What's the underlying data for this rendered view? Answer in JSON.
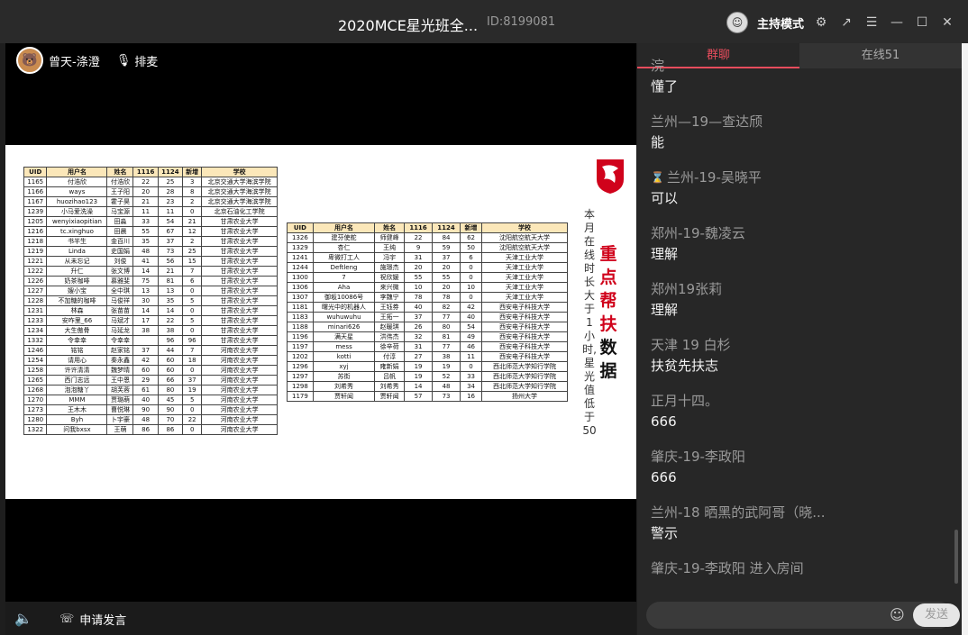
{
  "titlebar": {
    "title": "2020MCE星光班全...",
    "room_id": "ID:8199081",
    "host_mode": "主持模式"
  },
  "presenter": {
    "name": "曾天-涤澄",
    "mic_label": "排麦"
  },
  "bottom": {
    "apply_label": "申请发言"
  },
  "tabs": [
    {
      "label": "群聊"
    },
    {
      "label": "在线51"
    }
  ],
  "messages": [
    {
      "user": "浣",
      "text": "懂了"
    },
    {
      "user": "兰州—19—查达颀",
      "text": "能"
    },
    {
      "user": "兰州-19-吴晓平",
      "text": "可以",
      "badge": true
    },
    {
      "user": "郑州-19-魏凌云",
      "text": "理解"
    },
    {
      "user": "郑州19张莉",
      "text": "理解"
    },
    {
      "user": "天津 19 白杉",
      "text": "扶贫先扶志"
    },
    {
      "user": "正月十四。",
      "text": "666"
    },
    {
      "user": "肇庆-19-李政阳",
      "text": "666"
    },
    {
      "user": "兰州-18 晒黑的武阿哥（晓...",
      "text": "警示"
    },
    {
      "user": "肇庆-19-李政阳 进入房间",
      "text": ""
    }
  ],
  "send_label": "发送",
  "slide": {
    "side_gray": "本月在线时长大于1小时,星光值低于50",
    "side_red": "重点帮扶",
    "side_black": "数据",
    "headers": [
      "UID",
      "用户名",
      "姓名",
      "1116",
      "1124",
      "新增",
      "学校"
    ],
    "table1": [
      [
        "1165",
        "付浩欣",
        "付浩欣",
        "22",
        "25",
        "3",
        "北京交通大学海滨学院"
      ],
      [
        "1166",
        "ways",
        "王子阳",
        "20",
        "28",
        "8",
        "北京交通大学海滨学院"
      ],
      [
        "1167",
        "huozihao123",
        "霍子昊",
        "21",
        "23",
        "2",
        "北京交通大学海滨学院"
      ],
      [
        "1239",
        "小马爱洗澡",
        "马宝源",
        "11",
        "11",
        "0",
        "北京石油化工学院"
      ],
      [
        "1205",
        "wenyixiaopitian",
        "田淼",
        "33",
        "54",
        "21",
        "甘肃农业大学"
      ],
      [
        "1216",
        "tc.xinghuo",
        "田晨",
        "55",
        "67",
        "12",
        "甘肃农业大学"
      ],
      [
        "1218",
        "书半生",
        "金百川",
        "35",
        "37",
        "2",
        "甘肃农业大学"
      ],
      [
        "1219",
        "Linda",
        "史国娟",
        "48",
        "73",
        "25",
        "甘肃农业大学"
      ],
      [
        "1221",
        "从未忘记",
        "刘俊",
        "41",
        "56",
        "15",
        "甘肃农业大学"
      ],
      [
        "1222",
        "升仁",
        "张文博",
        "14",
        "21",
        "7",
        "甘肃农业大学"
      ],
      [
        "1226",
        "奶茶咖啡",
        "慕雅斐",
        "75",
        "81",
        "6",
        "甘肃农业大学"
      ],
      [
        "1227",
        "嫂小宝",
        "全中琪",
        "13",
        "13",
        "0",
        "甘肃农业大学"
      ],
      [
        "1228",
        "不加糖的咖啡",
        "马俊祥",
        "30",
        "35",
        "5",
        "甘肃农业大学"
      ],
      [
        "1231",
        "林森",
        "张苗苗",
        "14",
        "14",
        "0",
        "甘肃农业大学"
      ],
      [
        "1233",
        "安咋里_66",
        "马斌才",
        "17",
        "22",
        "5",
        "甘肃农业大学"
      ],
      [
        "1234",
        "大生傲骨",
        "马延龙",
        "38",
        "38",
        "0",
        "甘肃农业大学"
      ],
      [
        "1332",
        "令幸幸",
        "令幸幸",
        "",
        "96",
        "96",
        "甘肃农业大学"
      ],
      [
        "1246",
        "铭铭",
        "赵家铭",
        "37",
        "44",
        "7",
        "河南农业大学"
      ],
      [
        "1254",
        "请用心",
        "秦永鑫",
        "42",
        "60",
        "18",
        "河南农业大学"
      ],
      [
        "1258",
        "许许清清",
        "魏梦晴",
        "60",
        "60",
        "0",
        "河南农业大学"
      ],
      [
        "1265",
        "西门志远",
        "王中恩",
        "29",
        "66",
        "37",
        "河南农业大学"
      ],
      [
        "1268",
        "泡泡糖丫",
        "胡芙蓉",
        "61",
        "80",
        "19",
        "河南农业大学"
      ],
      [
        "1270",
        "MMM",
        "贾璐萌",
        "40",
        "45",
        "5",
        "河南农业大学"
      ],
      [
        "1273",
        "王木木",
        "曹悦琳",
        "90",
        "90",
        "0",
        "河南农业大学"
      ],
      [
        "1280",
        "Byh",
        "卜宇豪",
        "48",
        "70",
        "22",
        "河南农业大学"
      ],
      [
        "1322",
        "问我bxsx",
        "王萌",
        "86",
        "86",
        "0",
        "河南农业大学"
      ]
    ],
    "table2": [
      [
        "1326",
        "建芬使舵",
        "师健峰",
        "22",
        "84",
        "62",
        "沈阳航空航天大学"
      ],
      [
        "1329",
        "杏仁",
        "王纯",
        "9",
        "59",
        "50",
        "沈阳航空航天大学"
      ],
      [
        "1241",
        "卑微打工人",
        "冯宇",
        "31",
        "37",
        "6",
        "天津工业大学"
      ],
      [
        "1244",
        "Deftleng",
        "施璟杰",
        "20",
        "20",
        "0",
        "天津工业大学"
      ],
      [
        "1300",
        "7",
        "祝欣媛",
        "55",
        "55",
        "0",
        "天津工业大学"
      ],
      [
        "1306",
        "Aha",
        "来兴微",
        "10",
        "20",
        "10",
        "天津工业大学"
      ],
      [
        "1307",
        "御坂10086号",
        "李魏宁",
        "78",
        "78",
        "0",
        "天津工业大学"
      ],
      [
        "1181",
        "曙光中的机器人",
        "王钰券",
        "40",
        "82",
        "42",
        "西安电子科技大学"
      ],
      [
        "1183",
        "wuhuwuhu",
        "王拓一",
        "37",
        "77",
        "40",
        "西安电子科技大学"
      ],
      [
        "1188",
        "minari626",
        "赵暖琪",
        "26",
        "80",
        "54",
        "西安电子科技大学"
      ],
      [
        "1196",
        "满天星",
        "洪伟杰",
        "32",
        "81",
        "49",
        "西安电子科技大学"
      ],
      [
        "1197",
        "mess",
        "徐辛荷",
        "31",
        "77",
        "46",
        "西安电子科技大学"
      ],
      [
        "1202",
        "kotti",
        "付淳",
        "27",
        "38",
        "11",
        "西安电子科技大学"
      ],
      [
        "1296",
        "xyj",
        "雍新娟",
        "19",
        "19",
        "0",
        "西北师范大学知行学院"
      ],
      [
        "1297",
        "苏街",
        "吕帆",
        "19",
        "52",
        "33",
        "西北师范大学知行学院"
      ],
      [
        "1298",
        "刘希秀",
        "刘希秀",
        "14",
        "48",
        "34",
        "西北师范大学知行学院"
      ],
      [
        "1179",
        "贾轩闻",
        "贾轩闻",
        "57",
        "73",
        "16",
        "扬州大学"
      ]
    ]
  }
}
